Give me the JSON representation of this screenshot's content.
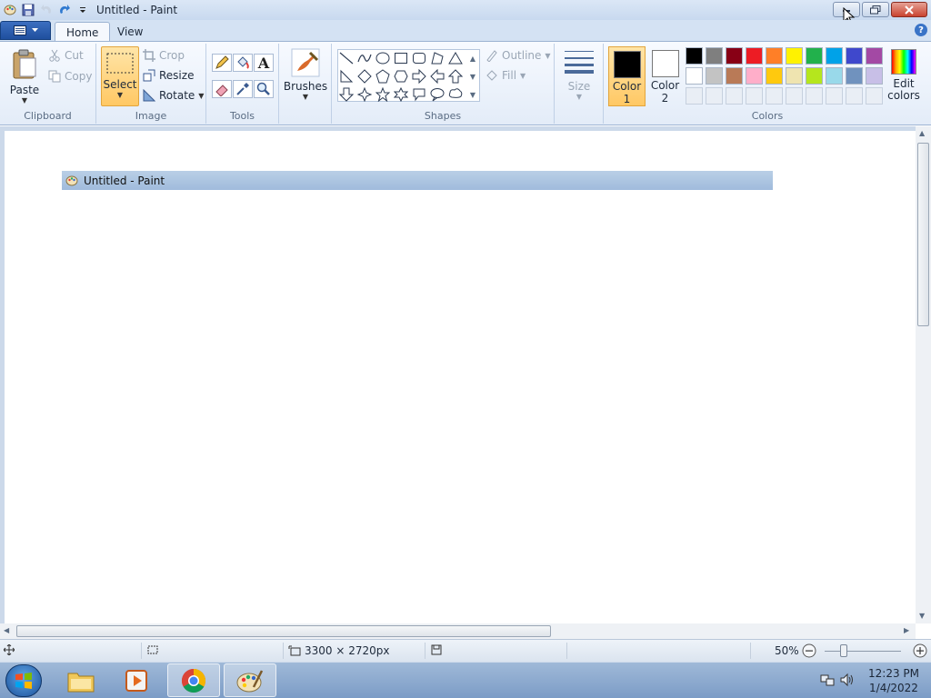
{
  "window": {
    "title": "Untitled - Paint"
  },
  "tabs": {
    "home": "Home",
    "view": "View"
  },
  "clipboard": {
    "paste": "Paste",
    "cut": "Cut",
    "copy": "Copy",
    "group_label": "Clipboard"
  },
  "image": {
    "select": "Select",
    "crop": "Crop",
    "resize": "Resize",
    "rotate": "Rotate",
    "group_label": "Image"
  },
  "tools": {
    "group_label": "Tools"
  },
  "brushes": {
    "label": "Brushes"
  },
  "shapes": {
    "outline": "Outline",
    "fill": "Fill",
    "group_label": "Shapes"
  },
  "size": {
    "label": "Size"
  },
  "colors": {
    "color1_label": "Color",
    "color1_num": "1",
    "color2_label": "Color",
    "color2_num": "2",
    "color1_value": "#000000",
    "color2_value": "#ffffff",
    "edit_label_1": "Edit",
    "edit_label_2": "colors",
    "group_label": "Colors",
    "palette_row1": [
      "#000000",
      "#7f7f7f",
      "#880015",
      "#ed1c24",
      "#ff7f27",
      "#fff200",
      "#22b14c",
      "#00a2e8",
      "#3f48cc",
      "#a349a4"
    ],
    "palette_row2": [
      "#ffffff",
      "#c3c3c3",
      "#b97a57",
      "#ffaec9",
      "#ffc90e",
      "#efe4b0",
      "#b5e61d",
      "#99d9ea",
      "#7092be",
      "#c8bfe7"
    ]
  },
  "canvas": {
    "inner_title": "Untitled - Paint"
  },
  "statusbar": {
    "dimensions": "3300 × 2720px",
    "zoom": "50%"
  },
  "taskbar": {
    "time": "12:23 PM",
    "date": "1/4/2022"
  }
}
